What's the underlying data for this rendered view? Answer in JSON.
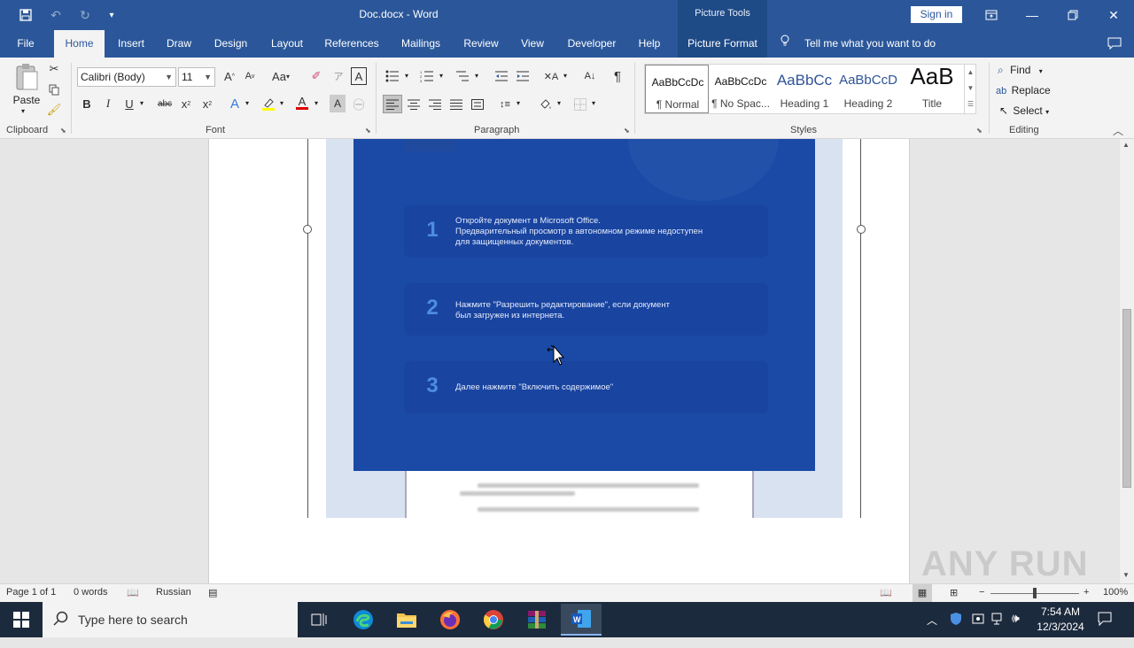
{
  "window": {
    "title": "Doc.docx  -  Word",
    "picture_tools_label": "Picture Tools",
    "sign_in": "Sign in"
  },
  "tabs": [
    {
      "label": "File"
    },
    {
      "label": "Home"
    },
    {
      "label": "Insert"
    },
    {
      "label": "Draw"
    },
    {
      "label": "Design"
    },
    {
      "label": "Layout"
    },
    {
      "label": "References"
    },
    {
      "label": "Mailings"
    },
    {
      "label": "Review"
    },
    {
      "label": "View"
    },
    {
      "label": "Developer"
    },
    {
      "label": "Help"
    },
    {
      "label": "Picture Format"
    }
  ],
  "tell_me": "Tell me what you want to do",
  "ribbon": {
    "clipboard": {
      "label": "Clipboard",
      "paste": "Paste"
    },
    "font": {
      "label": "Font",
      "font_name": "Calibri (Body)",
      "font_size": "11"
    },
    "paragraph": {
      "label": "Paragraph"
    },
    "styles": {
      "label": "Styles",
      "items": [
        {
          "preview": "AaBbCcDc",
          "name": "¶ Normal"
        },
        {
          "preview": "AaBbCcDc",
          "name": "¶ No Spac..."
        },
        {
          "preview": "AaBbCc",
          "name": "Heading 1"
        },
        {
          "preview": "AaBbCcD",
          "name": "Heading 2"
        },
        {
          "preview": "AaB",
          "name": "Title"
        }
      ]
    },
    "editing": {
      "label": "Editing",
      "find": "Find",
      "replace": "Replace",
      "select": "Select"
    }
  },
  "document": {
    "steps": [
      {
        "num": "1",
        "text": "Откройте документ в Microsoft Office.\nПредварительный просмотр в автономном режиме недоступен\nдля защищенных документов."
      },
      {
        "num": "2",
        "text": "Нажмите \"Разрешить редактирование\", если документ\nбыл загружен из интернета."
      },
      {
        "num": "3",
        "text": "Далее нажмите \"Включить содержимое\""
      }
    ]
  },
  "status": {
    "page": "Page 1 of 1",
    "words": "0 words",
    "language": "Russian",
    "zoom": "100%"
  },
  "taskbar": {
    "search_placeholder": "Type here to search",
    "time": "7:54 AM",
    "date": "12/3/2024"
  },
  "watermark": "ANY RUN",
  "colors": {
    "word_blue": "#2b579a",
    "image_blue": "#1a4aa6",
    "step_number": "#4d8de0"
  }
}
